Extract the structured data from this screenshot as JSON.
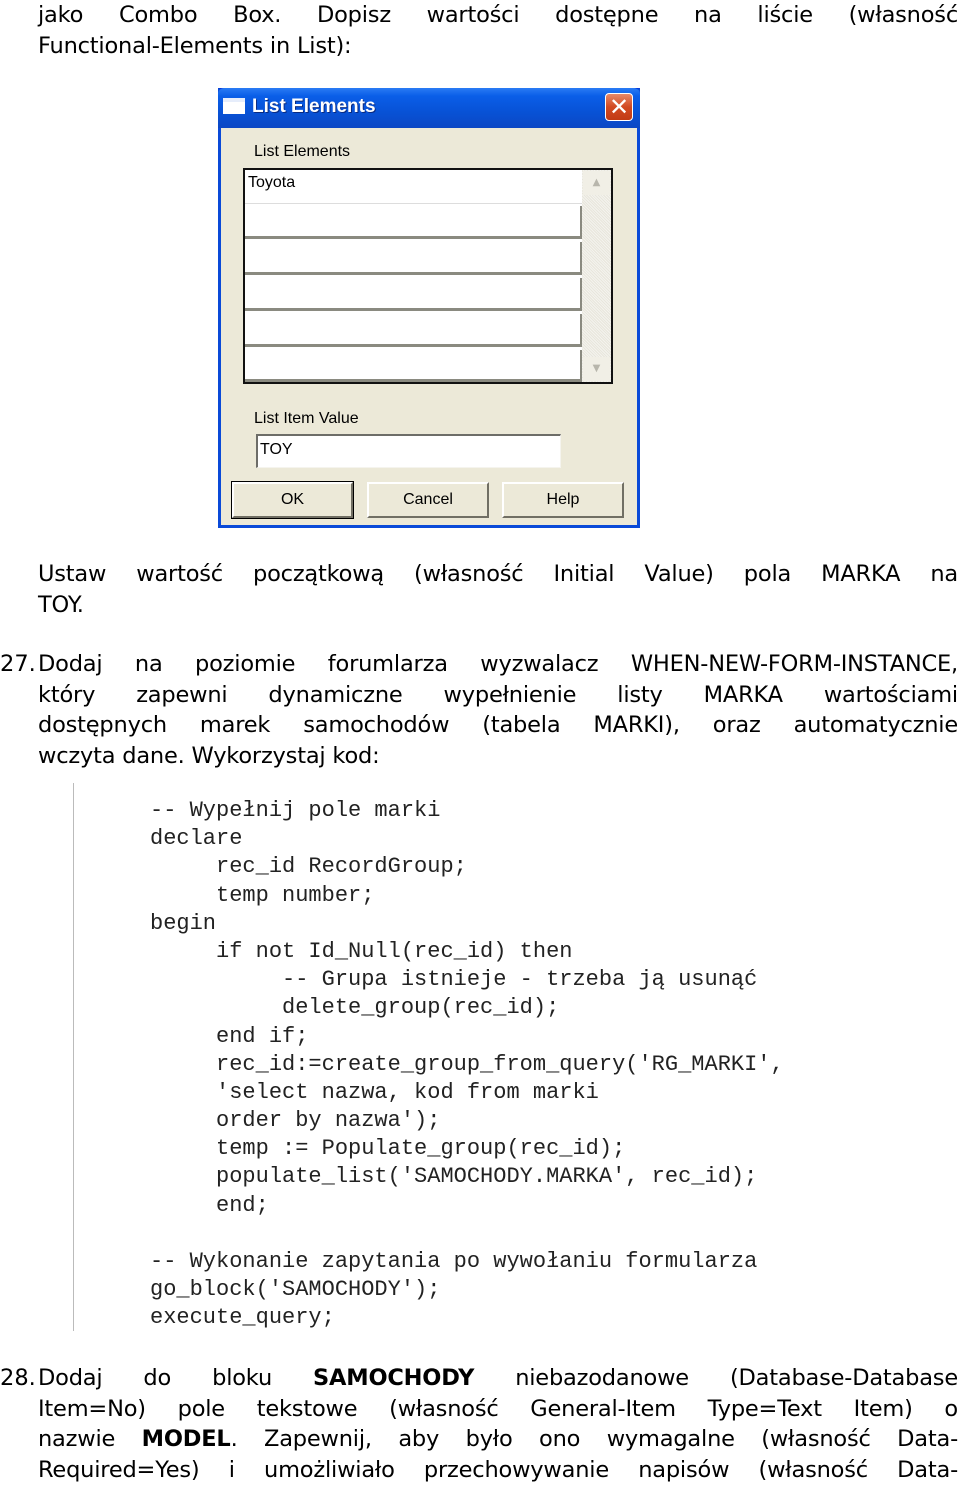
{
  "intro": {
    "lines": [
      "jako Combo Box. Dopisz wartości dostępne na liście (własność",
      "Functional-Elements in List):"
    ]
  },
  "dialog": {
    "title": "List Elements",
    "close_icon": "close-icon",
    "list_label": "List Elements",
    "list_label_access_key": "E",
    "list_items": [
      "Toyota",
      "",
      "",
      "",
      "",
      ""
    ],
    "scroll_up_icon": "▲",
    "scroll_down_icon": "▼",
    "value_label": "List Item Value",
    "value_label_access_key": "i",
    "value": "TOY",
    "buttons": {
      "ok": "OK",
      "cancel": "Cancel",
      "help": "Help"
    }
  },
  "initial_value_para": {
    "lines": [
      "Ustaw wartość początkową (własność Initial Value) pola MARKA na",
      "TOY."
    ]
  },
  "step27": {
    "number": "27.",
    "lines": [
      "Dodaj na poziomie forumlarza wyzwalacz WHEN-NEW-FORM-INSTANCE,",
      "który zapewni dynamiczne wypełnienie listy MARKA wartościami",
      "dostępnych marek samochodów (tabela MARKI), oraz automatycznie",
      "wczyta dane. Wykorzystaj kod:"
    ]
  },
  "code": {
    "lines": [
      "-- Wypełnij pole marki",
      "declare",
      "     rec_id RecordGroup;",
      "     temp number;",
      "begin",
      "     if not Id_Null(rec_id) then",
      "          -- Grupa istnieje - trzeba ją usunąć",
      "          delete_group(rec_id);",
      "     end if;",
      "     rec_id:=create_group_from_query('RG_MARKI',",
      "     'select nazwa, kod from marki",
      "     order by nazwa');",
      "     temp := Populate_group(rec_id);",
      "     populate_list('SAMOCHODY.MARKA', rec_id);",
      "     end;",
      "",
      "-- Wykonanie zapytania po wywołaniu formularza",
      "go_block('SAMOCHODY');",
      "execute_query;"
    ]
  },
  "step28": {
    "number": "28.",
    "line1_pre": "Dodaj do bloku ",
    "line1_bold": "SAMOCHODY",
    "line1_post": " niebazodanowe (Database-Database",
    "line2": "Item=No) pole tekstowe (własność General-Item Type=Text Item) o",
    "line3_pre": "nazwie ",
    "line3_bold": "MODEL",
    "line3_post": ". Zapewnij, aby było ono wymagalne (własność Data-",
    "line4": "Required=Yes) i umożliwiało przechowywanie napisów (własność Data-"
  }
}
